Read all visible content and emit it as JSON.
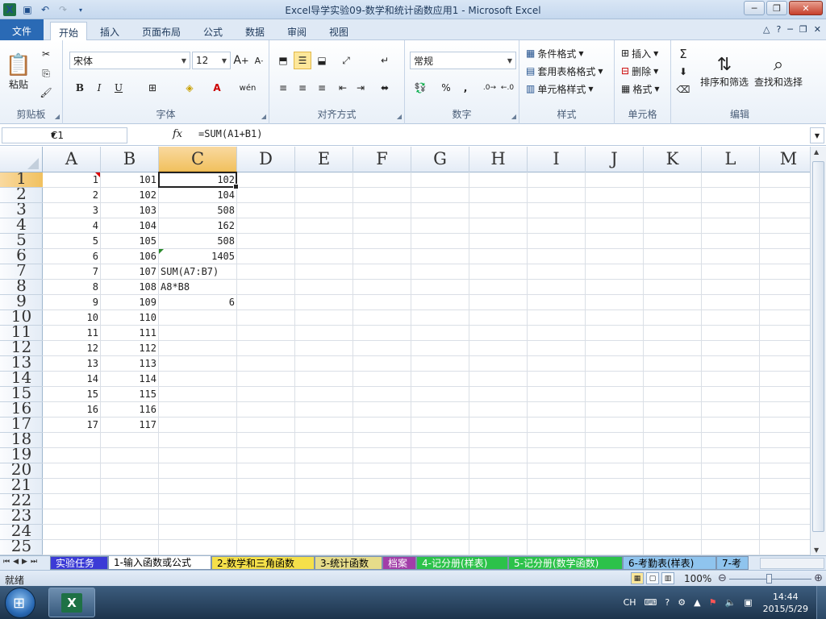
{
  "window": {
    "title": "Excel导学实验09-数学和统计函数应用1  -  Microsoft Excel"
  },
  "ribbon": {
    "tabs": [
      "文件",
      "开始",
      "插入",
      "页面布局",
      "公式",
      "数据",
      "审阅",
      "视图"
    ],
    "active_tab": "开始",
    "clipboard": {
      "paste": "粘贴",
      "label": "剪贴板"
    },
    "font": {
      "name": "宋体",
      "size": "12",
      "bold": "B",
      "italic": "I",
      "underline": "U",
      "label": "字体"
    },
    "alignment": {
      "label": "对齐方式"
    },
    "number": {
      "format": "常规",
      "percent": "%",
      "comma": ",",
      "label": "数字"
    },
    "styles": {
      "conditional": "条件格式",
      "table": "套用表格格式",
      "cell": "单元格样式",
      "label": "样式"
    },
    "cells": {
      "insert": "插入",
      "delete": "删除",
      "format": "格式",
      "label": "单元格"
    },
    "editing": {
      "sort": "排序和筛选",
      "find": "查找和选择",
      "label": "编辑"
    }
  },
  "formula_bar": {
    "name_box": "C1",
    "fx": "fx",
    "formula": "=SUM(A1+B1)"
  },
  "sheet": {
    "columns": [
      "A",
      "B",
      "C",
      "D",
      "E",
      "F",
      "G",
      "H",
      "I",
      "J",
      "K",
      "L",
      "M"
    ],
    "rows": [
      "1",
      "2",
      "3",
      "4",
      "5",
      "6",
      "7",
      "8",
      "9",
      "10",
      "11",
      "12",
      "13",
      "14",
      "15",
      "16",
      "17",
      "18",
      "19",
      "20",
      "21",
      "22",
      "23",
      "24",
      "25"
    ],
    "active_cell": "C1",
    "data": [
      [
        "1",
        "101",
        "102"
      ],
      [
        "2",
        "102",
        "104"
      ],
      [
        "3",
        "103",
        "508"
      ],
      [
        "4",
        "104",
        "162"
      ],
      [
        "5",
        "105",
        "508"
      ],
      [
        "6",
        "106",
        "1405"
      ],
      [
        "7",
        "107",
        "SUM(A7:B7)"
      ],
      [
        "8",
        "108",
        "A8*B8"
      ],
      [
        "9",
        "109",
        "6"
      ],
      [
        "10",
        "110",
        ""
      ],
      [
        "11",
        "111",
        ""
      ],
      [
        "12",
        "112",
        ""
      ],
      [
        "13",
        "113",
        ""
      ],
      [
        "14",
        "114",
        ""
      ],
      [
        "15",
        "115",
        ""
      ],
      [
        "16",
        "116",
        ""
      ],
      [
        "17",
        "117",
        ""
      ]
    ]
  },
  "sheet_tabs": [
    {
      "label": "实验任务",
      "color": "#3b3bd6",
      "text_color": "#ffffff"
    },
    {
      "label": "1-输入函数或公式",
      "color": "#ffffff",
      "text_color": "#000000",
      "active": true
    },
    {
      "label": "2-数学和三角函数",
      "color": "#f5e04a",
      "text_color": "#000000"
    },
    {
      "label": "3-统计函数",
      "color": "#e6dc8a",
      "text_color": "#000000"
    },
    {
      "label": "档案",
      "color": "#a23ea8",
      "text_color": "#ffffff"
    },
    {
      "label": "4-记分册(样表)",
      "color": "#2cc24a",
      "text_color": "#ffffff"
    },
    {
      "label": "5-记分册(数学函数)",
      "color": "#2cc24a",
      "text_color": "#ffffff"
    },
    {
      "label": "6-考勤表(样表)",
      "color": "#8fc4ee",
      "text_color": "#000000"
    },
    {
      "label": "7-考",
      "color": "#8fc4ee",
      "text_color": "#000000"
    }
  ],
  "status_bar": {
    "ready": "就绪",
    "zoom": "100%"
  },
  "taskbar": {
    "lang": "CH",
    "time": "14:44",
    "date": "2015/5/29"
  }
}
